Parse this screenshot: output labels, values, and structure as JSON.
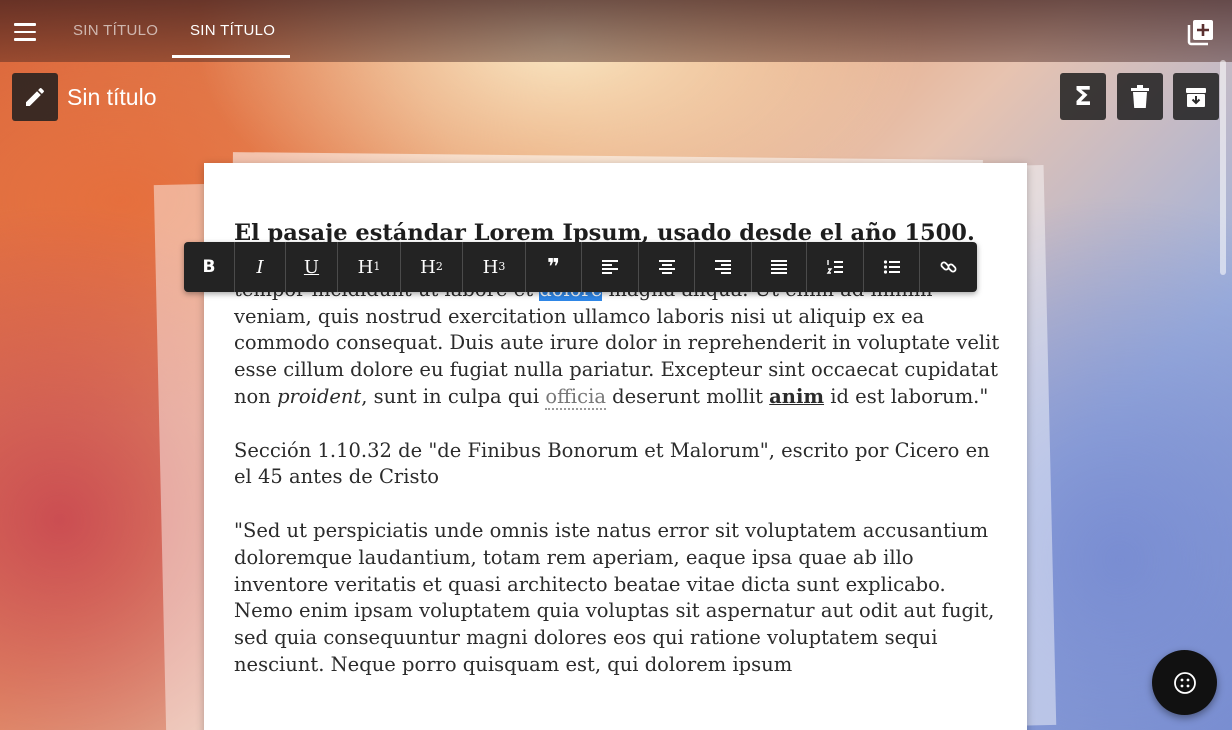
{
  "header": {
    "tabs": [
      {
        "label": "SIN TÍTULO",
        "active": false
      },
      {
        "label": "SIN TÍTULO",
        "active": true
      }
    ],
    "menu_icon": "hamburger-menu-icon",
    "add_icon": "add-note-icon"
  },
  "document": {
    "title": "Sin título",
    "edit_icon": "pencil-icon",
    "actions": [
      {
        "name": "formula-button",
        "icon": "sigma-icon",
        "glyph": "Σ"
      },
      {
        "name": "delete-button",
        "icon": "trash-icon"
      },
      {
        "name": "archive-button",
        "icon": "archive-icon"
      }
    ]
  },
  "toolbar": {
    "buttons": [
      {
        "name": "bold-button",
        "label": "B"
      },
      {
        "name": "italic-button",
        "label": "I"
      },
      {
        "name": "underline-button",
        "label": "U"
      },
      {
        "name": "h1-button",
        "label": "H",
        "sup": "1"
      },
      {
        "name": "h2-button",
        "label": "H",
        "sup": "2"
      },
      {
        "name": "h3-button",
        "label": "H",
        "sup": "3"
      },
      {
        "name": "quote-button",
        "label": "❞"
      },
      {
        "name": "align-left-button",
        "icon": "align-left-icon"
      },
      {
        "name": "align-center-button",
        "icon": "align-center-icon"
      },
      {
        "name": "align-right-button",
        "icon": "align-right-icon"
      },
      {
        "name": "justify-button",
        "icon": "justify-icon"
      },
      {
        "name": "ordered-list-button",
        "icon": "ordered-list-icon"
      },
      {
        "name": "unordered-list-button",
        "icon": "unordered-list-icon"
      },
      {
        "name": "link-button",
        "icon": "link-icon"
      }
    ]
  },
  "content": {
    "heading": "El pasaje estándar Lorem Ipsum, usado desde el año 1500.",
    "p1_a": "\"Lorem ipsum dolor sit amet, consectetur adipiscing elit, sed do eiusmod tempor incididunt ut labore et ",
    "p1_sel": "dolore",
    "p1_b": " magna aliqua. Ut enim ad minim veniam, quis nostrud exercitation ullamco laboris nisi ut aliquip ex ea commodo consequat. Duis aute irure dolor in reprehenderit in voluptate velit esse cillum dolore eu fugiat nulla pariatur. Excepteur sint occaecat cupidatat non ",
    "p1_em": "proident",
    "p1_c": ", sunt in culpa qui ",
    "p1_dotted": "officia",
    "p1_d": " deserunt mollit ",
    "p1_strong": "anim",
    "p1_e": " id est laborum.\"",
    "p2": "Sección 1.10.32 de \"de Finibus Bonorum et Malorum\", escrito por Cicero en el 45 antes de Cristo",
    "p3": "\"Sed ut perspiciatis unde omnis iste natus error sit voluptatem accusantium doloremque laudantium, totam rem aperiam, eaque ipsa quae ab illo inventore veritatis et quasi architecto beatae vitae dicta sunt explicabo. Nemo enim ipsam voluptatem quia voluptas sit aspernatur aut odit aut fugit, sed quia consequuntur magni dolores eos qui ratione voluptatem sequi nesciunt. Neque porro quisquam est, qui dolorem ipsum"
  },
  "fab": {
    "icon": "dots-menu-icon"
  }
}
